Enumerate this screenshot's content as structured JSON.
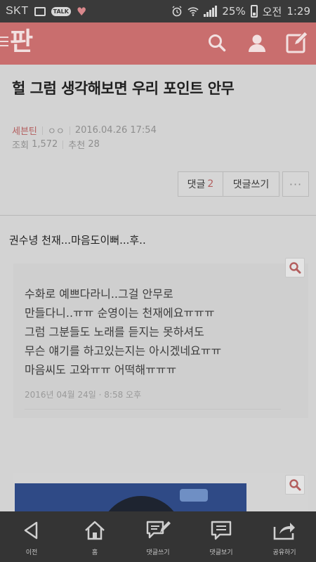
{
  "status_bar": {
    "carrier": "SKT",
    "talk_badge": "TALK",
    "battery": "25%",
    "ampm": "오전",
    "time": "1:29"
  },
  "app_bar": {
    "logo": "판",
    "brand_color": "#c96e6e",
    "icons": [
      "search-icon",
      "user-icon",
      "edit-icon"
    ]
  },
  "article": {
    "title": "헐 그럼 생각해보면 우리 포인트 안무",
    "author": "세븐틴",
    "author_sub": "ㅇㅇ",
    "datetime": "2016.04.26 17:54",
    "views_label": "조회",
    "views": "1,572",
    "recommend_label": "추천",
    "recommend": "28"
  },
  "actions": {
    "comment_label": "댓글",
    "comment_count": "2",
    "write_comment": "댓글쓰기",
    "more": "···"
  },
  "body": {
    "subtitle": "권수녕 천재...마음도이뻐...후..",
    "quote_lines": [
      "수화로 예쁘다라니..그걸 안무로",
      "만들다니..ㅠㅠ 순영이는 천재에요ㅠㅠㅠ",
      "그럼 그분들도 노래를 듣지는 못하셔도",
      "무슨 얘기를 하고있는지는 아시겠네요ㅠㅠ",
      "마음씨도 고와ㅠㅠ 어떡해ㅠㅠㅠ"
    ],
    "quote_date": "2016년 04월 24일 · 8:58 오후"
  },
  "bottom_nav": [
    {
      "label": "이전",
      "icon": "back-arrow-icon"
    },
    {
      "label": "홈",
      "icon": "home-icon"
    },
    {
      "label": "댓글쓰기",
      "icon": "comment-write-icon"
    },
    {
      "label": "댓글보기",
      "icon": "comment-view-icon"
    },
    {
      "label": "공유하기",
      "icon": "share-icon"
    }
  ]
}
